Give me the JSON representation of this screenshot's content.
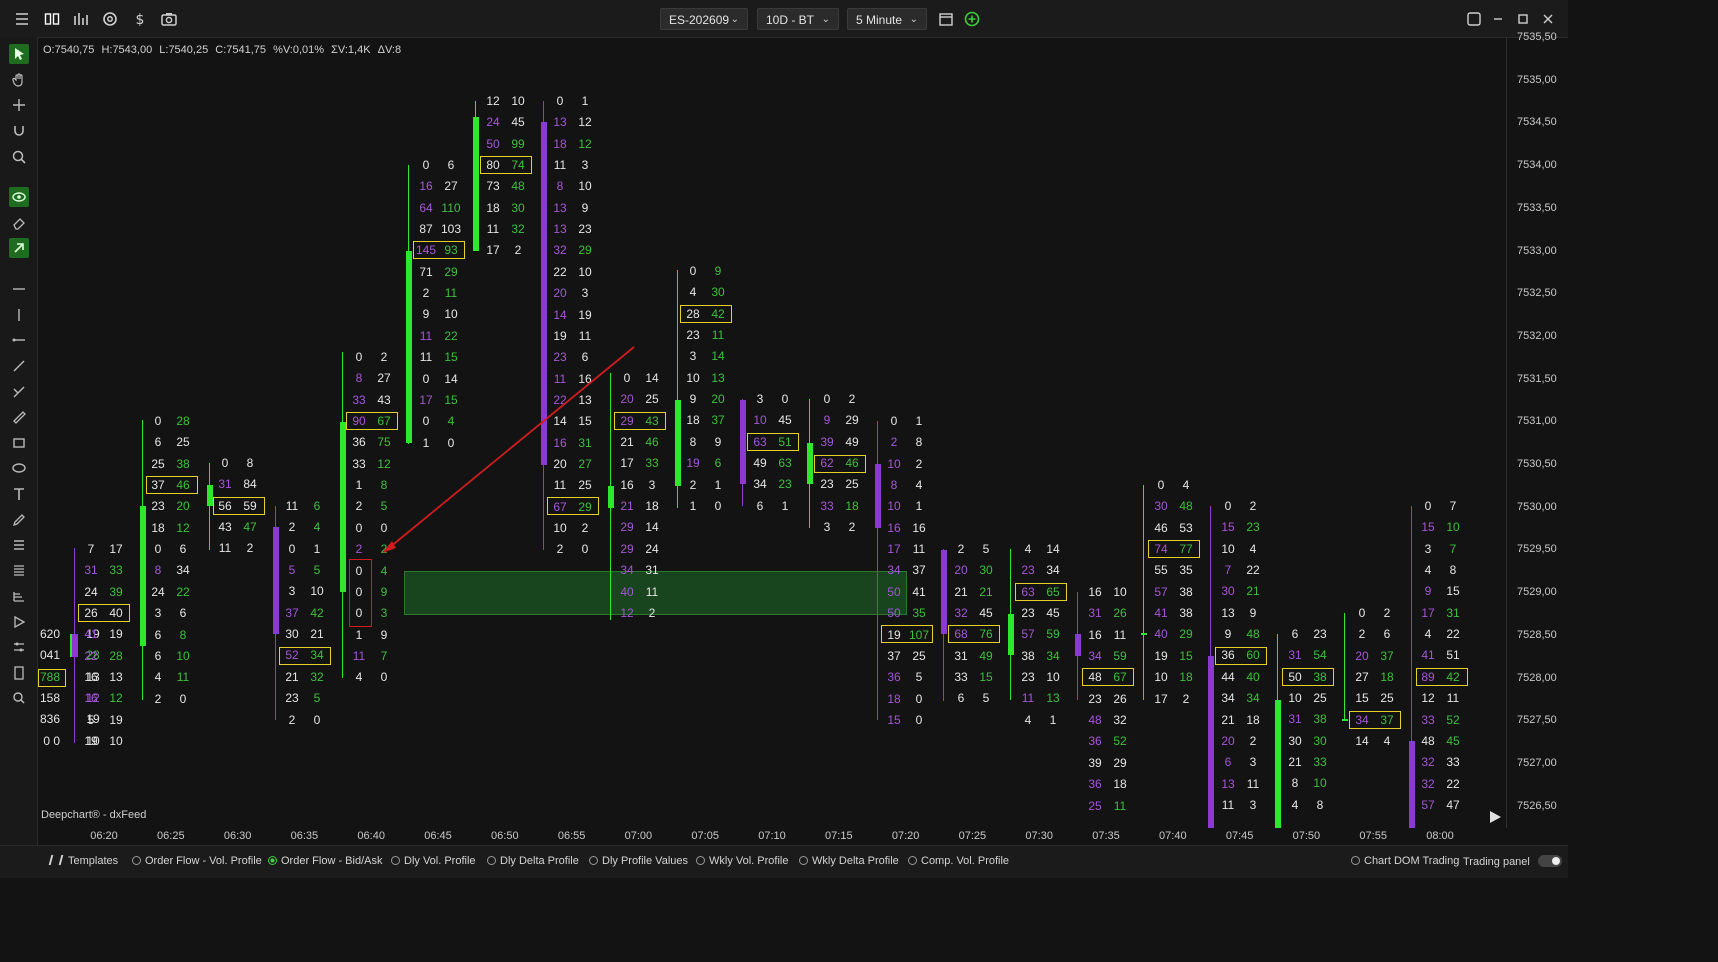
{
  "toolbar": {
    "symbol": "ES-202609",
    "range": "10D - BT",
    "interval": "5 Minute"
  },
  "ohlc": {
    "open": "O:7540,75",
    "high": "H:7543,00",
    "low": "L:7540,25",
    "close": "C:7541,75",
    "pct_v": "%V:0,01%",
    "sum_v": "ΣV:1,4K",
    "delta_v": "ΔV:8"
  },
  "watermark": "Deepchart® - dxFeed",
  "price_axis": [
    "7535,50",
    "7535,00",
    "7534,50",
    "7534,00",
    "7533,50",
    "7533,00",
    "7532,50",
    "7532,00",
    "7531,50",
    "7531,00",
    "7530,50",
    "7530,00",
    "7529,50",
    "7529,00",
    "7528,50",
    "7528,00",
    "7527,50",
    "7527,00",
    "7526,50"
  ],
  "time_axis": [
    "06:20",
    "06:25",
    "06:30",
    "06:35",
    "06:40",
    "06:45",
    "06:50",
    "06:55",
    "07:00",
    "07:05",
    "07:10",
    "07:15",
    "07:20",
    "07:25",
    "07:30",
    "07:35",
    "07:40",
    "07:45",
    "07:50",
    "07:55",
    "08:00"
  ],
  "colors": {
    "bid_purple": "#a656d8",
    "ask_green": "#3ec03e",
    "up_candle": "#2ee82e",
    "down_candle": "#8a3ad0",
    "box": "#e6d12b",
    "marker": "#d01c1c"
  },
  "bottom": {
    "templates_label": "Templates",
    "templates": [
      {
        "label": "Order Flow - Vol. Profile",
        "selected": false
      },
      {
        "label": "Order Flow - Bid/Ask",
        "selected": true
      },
      {
        "label": "Dly Vol. Profile",
        "selected": false
      },
      {
        "label": "Dly Delta Profile",
        "selected": false
      },
      {
        "label": "Dly Profile Values",
        "selected": false
      },
      {
        "label": "Wkly Vol. Profile",
        "selected": false
      },
      {
        "label": "Wkly Delta Profile",
        "selected": false
      },
      {
        "label": "Comp. Vol. Profile",
        "selected": false
      }
    ],
    "chart_dom": "Chart DOM Trading",
    "trading_panel": "Trading panel"
  },
  "footprint": [
    {
      "rows": [
        [
          0,
          "620",
          "19w"
        ],
        [
          1,
          "041",
          "28g"
        ],
        [
          2,
          "788",
          "13w"
        ],
        [
          3,
          "158",
          "12p"
        ],
        [
          4,
          "836",
          "19w"
        ],
        [
          5,
          "0 0",
          "10w"
        ]
      ],
      "leftOnly": true
    },
    {
      "time": "06:20",
      "rows": [
        [
          "7",
          "17"
        ],
        [
          "31p",
          "33g"
        ],
        [
          "24",
          "39g"
        ],
        [
          "26",
          "40"
        ],
        [
          "41p",
          "19"
        ],
        [
          "22p",
          "28g"
        ],
        [
          "16",
          "13"
        ],
        [
          "16p",
          "12g"
        ],
        [
          "5",
          "19"
        ],
        [
          "19",
          "10"
        ]
      ]
    },
    {
      "time": "06:25",
      "rows": [
        [
          "0",
          "28g"
        ],
        [
          "6",
          "25"
        ],
        [
          "25",
          "38g"
        ],
        [
          "37",
          "46g"
        ],
        [
          "23",
          "20g"
        ],
        [
          "18",
          "12g"
        ],
        [
          "0",
          "6"
        ],
        [
          "8p",
          "34"
        ],
        [
          "24",
          "22g"
        ],
        [
          "3",
          "6"
        ],
        [
          "6",
          "8g"
        ],
        [
          "6",
          "10g"
        ],
        [
          "4",
          "11g"
        ],
        [
          "2",
          "0"
        ]
      ]
    },
    {
      "time": "06:30",
      "rows": [
        [
          "0",
          "8"
        ],
        [
          "31p",
          "84"
        ],
        [
          "56",
          "59"
        ],
        [
          "43",
          "47g"
        ],
        [
          "11",
          "2"
        ]
      ]
    },
    {
      "time": "06:35",
      "rows": [
        [
          "11",
          "6g"
        ],
        [
          "2",
          "4g"
        ],
        [
          "0",
          "1"
        ],
        [
          "5p",
          "5g"
        ],
        [
          "3",
          "10"
        ],
        [
          "37p",
          "42g"
        ],
        [
          "30",
          "21"
        ],
        [
          "52p",
          "34g"
        ],
        [
          "21",
          "32g"
        ],
        [
          "23",
          "5g"
        ],
        [
          "2",
          "0"
        ]
      ]
    },
    {
      "time": "06:40",
      "rows": [
        [
          "0",
          "2"
        ],
        [
          "8p",
          "27"
        ],
        [
          "33p",
          "43"
        ],
        [
          "90p",
          "67g"
        ],
        [
          "36",
          "75g"
        ],
        [
          "33",
          "12g"
        ],
        [
          "1",
          "8g"
        ],
        [
          "2",
          "5g"
        ],
        [
          "0",
          "0"
        ],
        [
          "2p",
          "2g"
        ],
        [
          "0",
          "4g"
        ],
        [
          "0",
          "9g"
        ],
        [
          "0",
          "3g"
        ],
        [
          "1",
          "9"
        ],
        [
          "11p",
          "7g"
        ],
        [
          "4",
          "0"
        ]
      ]
    },
    {
      "time": "06:45",
      "rows": [
        [
          "0",
          "6"
        ],
        [
          "16p",
          "27"
        ],
        [
          "64p",
          "110g"
        ],
        [
          "87",
          "103"
        ],
        [
          "145p",
          "93g"
        ],
        [
          "71",
          "29g"
        ],
        [
          "2",
          "11g"
        ],
        [
          "9",
          "10"
        ],
        [
          "11p",
          "22g"
        ],
        [
          "11",
          "15g"
        ],
        [
          "0",
          "14"
        ],
        [
          "17p",
          "15g"
        ],
        [
          "0",
          "4g"
        ],
        [
          "1",
          "0"
        ]
      ]
    },
    {
      "time": "06:50",
      "rows": [
        [
          "12",
          "10"
        ],
        [
          "24p",
          "45"
        ],
        [
          "50p",
          "99g"
        ],
        [
          "80",
          "74g"
        ],
        [
          "73",
          "48g"
        ],
        [
          "18",
          "30g"
        ],
        [
          "11",
          "32g"
        ],
        [
          "17",
          "2"
        ]
      ]
    },
    {
      "time": "06:55",
      "rows": [
        [
          "0",
          "1"
        ],
        [
          "13p",
          "12"
        ],
        [
          "18p",
          "12g"
        ],
        [
          "11",
          "3"
        ],
        [
          "8p",
          "10"
        ],
        [
          "13p",
          "9"
        ],
        [
          "13p",
          "23"
        ],
        [
          "32p",
          "29g"
        ],
        [
          "22",
          "10"
        ],
        [
          "20p",
          "3"
        ],
        [
          "14p",
          "19"
        ],
        [
          "19",
          "11"
        ],
        [
          "23p",
          "6"
        ],
        [
          "11p",
          "16"
        ],
        [
          "22p",
          "13"
        ],
        [
          "14",
          "15"
        ],
        [
          "16p",
          "31g"
        ],
        [
          "20",
          "27g"
        ],
        [
          "11",
          "25"
        ],
        [
          "67p",
          "29g"
        ],
        [
          "10",
          "2"
        ],
        [
          "2",
          "0"
        ]
      ]
    },
    {
      "time": "07:00",
      "rows": [
        [
          "0",
          "14"
        ],
        [
          "20p",
          "25"
        ],
        [
          "29p",
          "43g"
        ],
        [
          "21",
          "46g"
        ],
        [
          "17",
          "33g"
        ],
        [
          "16",
          "3"
        ],
        [
          "21p",
          "18"
        ],
        [
          "29p",
          "14"
        ],
        [
          "29p",
          "24"
        ],
        [
          "34p",
          "31"
        ],
        [
          "40p",
          "11"
        ],
        [
          "12p",
          "2"
        ]
      ]
    },
    {
      "time": "07:05",
      "rows": [
        [
          "0",
          "9g"
        ],
        [
          "4",
          "30g"
        ],
        [
          "28",
          "42g"
        ],
        [
          "23",
          "11g"
        ],
        [
          "3",
          "14g"
        ],
        [
          "10",
          "13g"
        ],
        [
          "9",
          "20g"
        ],
        [
          "18",
          "37g"
        ],
        [
          "8",
          "9"
        ],
        [
          "19p",
          "6g"
        ],
        [
          "2",
          "1"
        ],
        [
          "1",
          "0"
        ]
      ]
    },
    {
      "time": "07:10",
      "rows": [
        [
          "3",
          "0"
        ],
        [
          "10p",
          "45"
        ],
        [
          "63p",
          "51g"
        ],
        [
          "49",
          "63g"
        ],
        [
          "34",
          "23g"
        ],
        [
          "6",
          "1"
        ]
      ]
    },
    {
      "time": "07:15",
      "rows": [
        [
          "0",
          "2"
        ],
        [
          "9p",
          "29"
        ],
        [
          "39p",
          "49"
        ],
        [
          "62p",
          "46g"
        ],
        [
          "23",
          "25"
        ],
        [
          "33p",
          "18g"
        ],
        [
          "3",
          "2"
        ]
      ]
    },
    {
      "time": "07:20",
      "rows": [
        [
          "0",
          "1"
        ],
        [
          "2p",
          "8"
        ],
        [
          "10p",
          "2"
        ],
        [
          "8p",
          "4"
        ],
        [
          "10p",
          "1"
        ],
        [
          "16p",
          "16"
        ],
        [
          "17p",
          "11"
        ],
        [
          "34p",
          "37"
        ],
        [
          "50p",
          "41"
        ],
        [
          "50p",
          "35g"
        ],
        [
          "19",
          "107g"
        ],
        [
          "37",
          "25"
        ],
        [
          "36p",
          "5"
        ],
        [
          "18p",
          "0"
        ],
        [
          "15p",
          "0"
        ]
      ]
    },
    {
      "time": "07:25",
      "rows": [
        [
          "2",
          "5"
        ],
        [
          "20p",
          "30g"
        ],
        [
          "21",
          "21g"
        ],
        [
          "32p",
          "45"
        ],
        [
          "68p",
          "76g"
        ],
        [
          "31",
          "49g"
        ],
        [
          "33",
          "15g"
        ],
        [
          "6",
          "5"
        ]
      ]
    },
    {
      "time": "07:30",
      "rows": [
        [
          "4",
          "14"
        ],
        [
          "23p",
          "34"
        ],
        [
          "63p",
          "65g"
        ],
        [
          "23",
          "45"
        ],
        [
          "57p",
          "59g"
        ],
        [
          "38",
          "34g"
        ],
        [
          "23",
          "10"
        ],
        [
          "11p",
          "13g"
        ],
        [
          "4",
          "1"
        ]
      ]
    },
    {
      "time": "07:35",
      "rows": [
        [
          "16",
          "10"
        ],
        [
          "31p",
          "26g"
        ],
        [
          "16",
          "11"
        ],
        [
          "34p",
          "59g"
        ],
        [
          "48",
          "67g"
        ],
        [
          "23",
          "26"
        ],
        [
          "48p",
          "32"
        ],
        [
          "36p",
          "52g"
        ],
        [
          "39",
          "29"
        ],
        [
          "36p",
          "18"
        ],
        [
          "25p",
          "11g"
        ]
      ]
    },
    {
      "time": "07:40",
      "rows": [
        [
          "0",
          "4"
        ],
        [
          "30p",
          "48g"
        ],
        [
          "46",
          "53"
        ],
        [
          "74p",
          "77g"
        ],
        [
          "55",
          "35"
        ],
        [
          "57p",
          "38"
        ],
        [
          "41p",
          "38"
        ],
        [
          "40p",
          "29g"
        ],
        [
          "19",
          "15g"
        ],
        [
          "10",
          "18g"
        ],
        [
          "17",
          "2"
        ]
      ]
    },
    {
      "time": "07:45",
      "rows": [
        [
          "0",
          "2"
        ],
        [
          "15p",
          "23g"
        ],
        [
          "10",
          "4"
        ],
        [
          "7p",
          "22"
        ],
        [
          "30p",
          "21g"
        ],
        [
          "13",
          "9"
        ],
        [
          "9",
          "48g"
        ],
        [
          "36",
          "60g"
        ],
        [
          "44",
          "40g"
        ],
        [
          "34",
          "34g"
        ],
        [
          "21",
          "18"
        ],
        [
          "20p",
          "2"
        ],
        [
          "6p",
          "3"
        ],
        [
          "13p",
          "11"
        ],
        [
          "11",
          "3"
        ]
      ]
    },
    {
      "time": "07:50",
      "rows": [
        [
          "6",
          "23"
        ],
        [
          "31p",
          "54g"
        ],
        [
          "50",
          "38g"
        ],
        [
          "10",
          "25"
        ],
        [
          "31p",
          "38g"
        ],
        [
          "30",
          "30g"
        ],
        [
          "21",
          "33g"
        ],
        [
          "8",
          "10g"
        ],
        [
          "4",
          "8"
        ]
      ]
    },
    {
      "time": "07:55",
      "rows": [
        [
          "0",
          "2"
        ],
        [
          "2",
          "6"
        ],
        [
          "20p",
          "37g"
        ],
        [
          "27",
          "18g"
        ],
        [
          "15",
          "25"
        ],
        [
          "34p",
          "37g"
        ],
        [
          "14",
          "4"
        ]
      ]
    },
    {
      "time": "08:00",
      "rows": [
        [
          "0",
          "7"
        ],
        [
          "15p",
          "10g"
        ],
        [
          "3",
          "7g"
        ],
        [
          "4",
          "8"
        ],
        [
          "9p",
          "15"
        ],
        [
          "17p",
          "31g"
        ],
        [
          "4",
          "22"
        ],
        [
          "41p",
          "51"
        ],
        [
          "89p",
          "42g"
        ],
        [
          "12",
          "11"
        ],
        [
          "33p",
          "52g"
        ],
        [
          "48",
          "45g"
        ],
        [
          "32p",
          "33"
        ],
        [
          "32p",
          "22"
        ],
        [
          "57p",
          "47"
        ]
      ]
    }
  ]
}
